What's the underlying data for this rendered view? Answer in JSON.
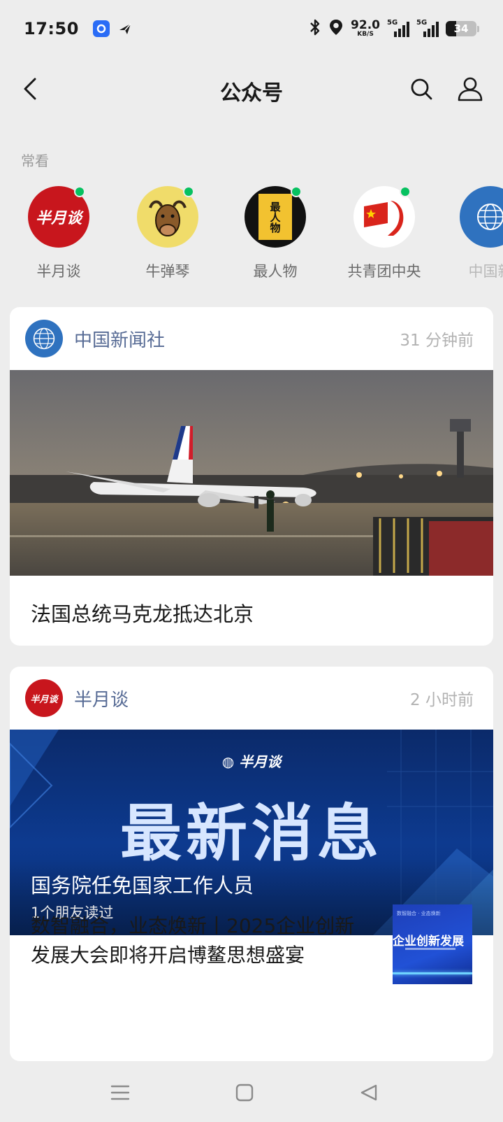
{
  "status_bar": {
    "time": "17:50",
    "net_speed": "92.0",
    "net_unit": "KB/S",
    "sim1_type": "5G",
    "sim2_type": "5G",
    "battery": "34",
    "battery_level_percent": 34
  },
  "nav": {
    "title": "公众号",
    "back_icon": "back-chevron-icon",
    "search_icon": "search-icon",
    "profile_icon": "person-icon"
  },
  "frequent": {
    "label": "常看",
    "items": [
      {
        "name": "半月谈",
        "avatar_text": "半月谈",
        "unread": true
      },
      {
        "name": "牛弹琴",
        "avatar_text": "",
        "unread": true
      },
      {
        "name": "最人物",
        "avatar_text": "最人物",
        "unread": true
      },
      {
        "name": "共青团中央",
        "avatar_text": "",
        "unread": true
      },
      {
        "name": "中国新",
        "avatar_text": "",
        "unread": false
      }
    ]
  },
  "feed": [
    {
      "account": "中国新闻社",
      "time": "31 分钟前",
      "title": "法国总统马克龙抵达北京"
    },
    {
      "account": "半月谈",
      "time": "2 小时前",
      "banner_brand": "半月谈",
      "banner_headline": "最新消息",
      "title": "国务院任免国家工作人员",
      "friends_read": "1个朋友读过",
      "sub_article": {
        "title": "数智融合，业态焕新丨2025企业创新发展大会即将开启博鳌思想盛宴",
        "thumb_top_text": "数智融合 · 业态焕新",
        "thumb_main_text": "企业创新发展"
      }
    }
  ],
  "colors": {
    "background": "#ededed",
    "link_blue": "#576b95",
    "unread_dot": "#07c160"
  }
}
